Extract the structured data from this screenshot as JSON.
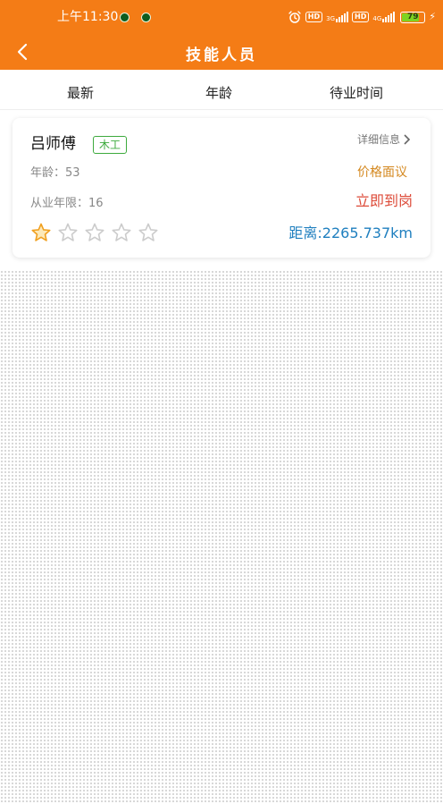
{
  "status_bar": {
    "time": "上午11:30",
    "hd_label": "HD",
    "network_1": "3G",
    "network_2": "4G",
    "battery_level": "79",
    "battery_percent": 79,
    "battery_color": "#7ed321"
  },
  "nav": {
    "back_icon": "chevron-left-icon",
    "title": "技能人员",
    "background_color": "#f47c16"
  },
  "tabs": [
    {
      "label": "最新"
    },
    {
      "label": "年龄"
    },
    {
      "label": "待业时间"
    }
  ],
  "worker": {
    "name": "吕师傅",
    "trade": "木工",
    "detail_link": "详细信息",
    "age_label": "年龄：",
    "age_value": "53",
    "experience_label": "从业年限：",
    "experience_value": "16",
    "price": "价格面议",
    "availability": "立即到岗",
    "distance": "距离:2265.737km",
    "rating": 1,
    "rating_max": 5,
    "colors": {
      "tag": "#3daa3d",
      "price": "#d4881f",
      "availability": "#dd4b39",
      "distance": "#1f7fbf",
      "star_filled": "#f0a020",
      "star_empty": "#cccccc"
    }
  }
}
